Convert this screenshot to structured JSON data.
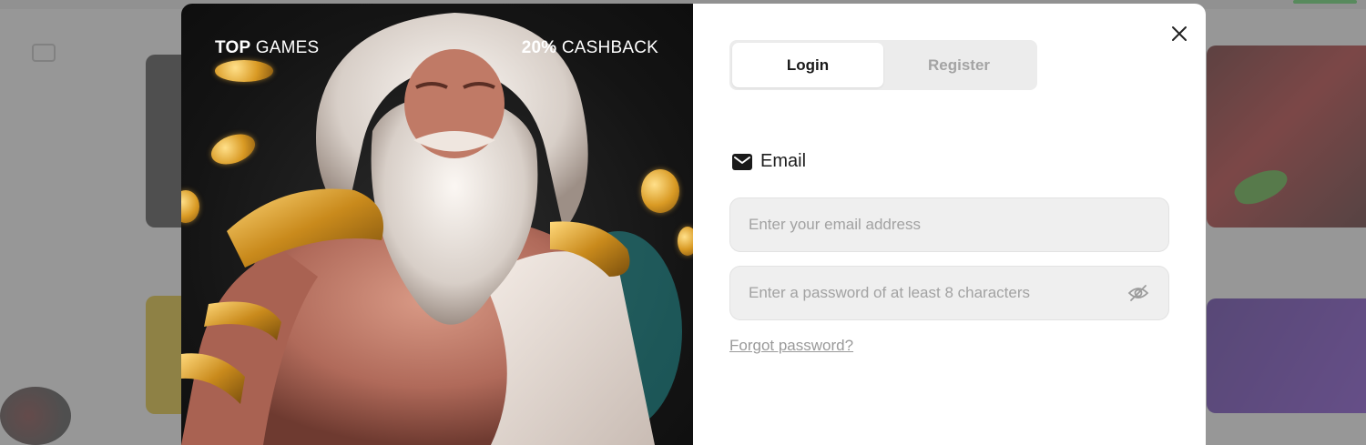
{
  "promo": {
    "left_bold": "TOP",
    "left_rest": " GAMES",
    "right_bold": "20%",
    "right_rest": " CASHBACK",
    "image_subject": "bearded-god-character-illustration"
  },
  "auth": {
    "tabs": [
      {
        "label": "Login",
        "active": true
      },
      {
        "label": "Register",
        "active": false
      }
    ],
    "method_label": "Email",
    "email_placeholder": "Enter your email address",
    "password_placeholder": "Enter a password of at least 8 characters",
    "forgot_label": "Forgot password?"
  },
  "icons": {
    "close": "close-icon",
    "email": "envelope-icon",
    "eye": "eye-off-icon"
  },
  "colors": {
    "accent_dark": "#1a1a1a",
    "input_bg": "#efefef",
    "promo_bg": "#141414",
    "gold": "#d99a24"
  }
}
